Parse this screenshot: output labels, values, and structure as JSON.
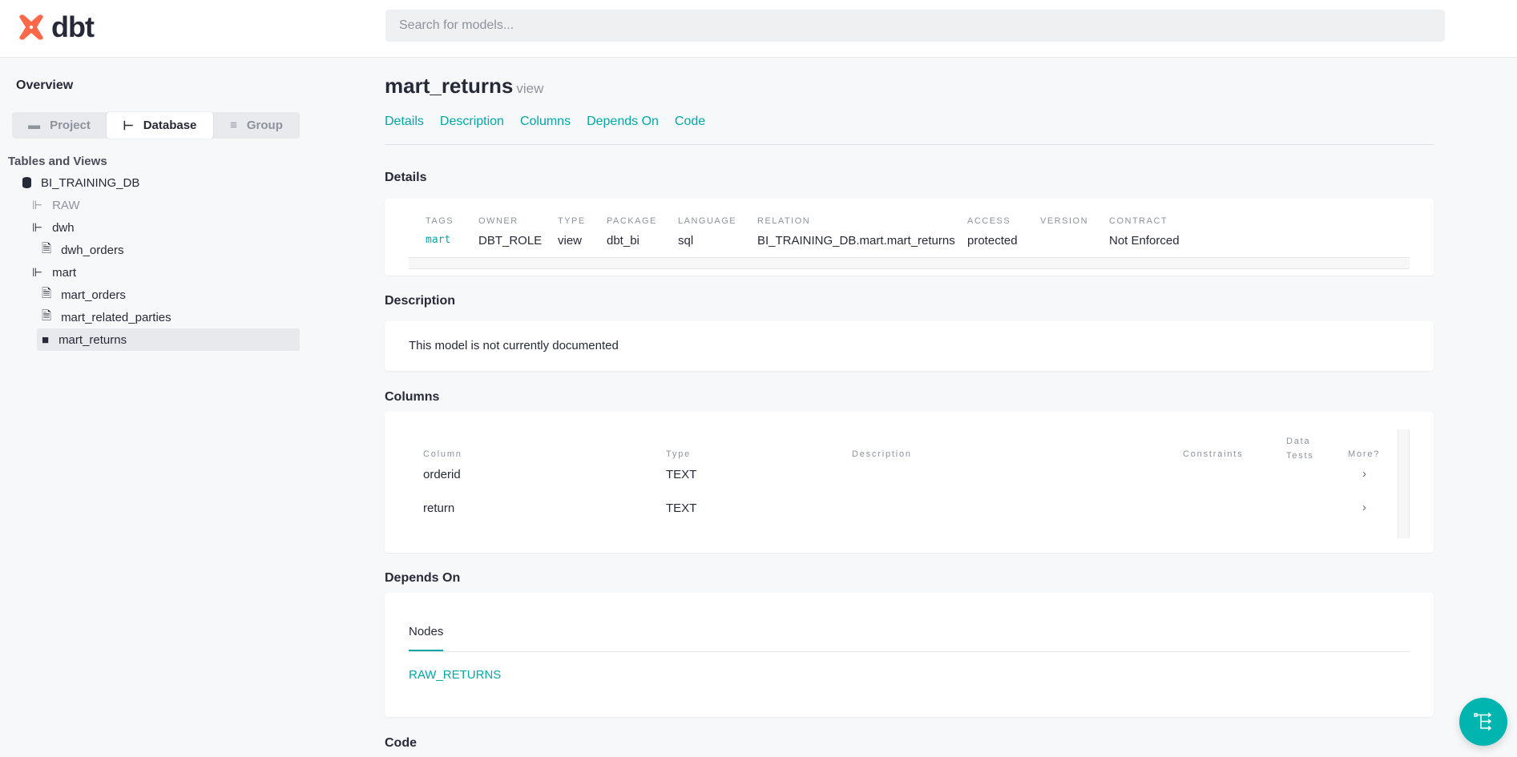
{
  "header": {
    "logo": "dbt",
    "search_placeholder": "Search for models..."
  },
  "sidebar": {
    "overview": "Overview",
    "tabs": [
      "Project",
      "Database",
      "Group"
    ],
    "section": "Tables and Views",
    "tree": [
      {
        "label": "BI_TRAINING_DB",
        "icon": "database"
      },
      {
        "label": "RAW",
        "icon": "schema"
      },
      {
        "label": "dwh",
        "icon": "schema"
      },
      {
        "label": "dwh_orders",
        "icon": "file"
      },
      {
        "label": "mart",
        "icon": "schema"
      },
      {
        "label": "mart_orders",
        "icon": "file"
      },
      {
        "label": "mart_related_parties",
        "icon": "file"
      },
      {
        "label": "mart_returns",
        "icon": "file"
      }
    ]
  },
  "model": {
    "name": "mart_returns",
    "kind": "view"
  },
  "nav": [
    "Details",
    "Description",
    "Columns",
    "Depends On",
    "Code"
  ],
  "details": {
    "heading": "Details",
    "fields": [
      {
        "label": "Tags",
        "value": "mart"
      },
      {
        "label": "Owner",
        "value": "DBT_ROLE"
      },
      {
        "label": "Type",
        "value": "view"
      },
      {
        "label": "Package",
        "value": "dbt_bi"
      },
      {
        "label": "Language",
        "value": "sql"
      },
      {
        "label": "Relation",
        "value": "BI_TRAINING_DB.mart.mart_returns"
      },
      {
        "label": "Access",
        "value": "protected"
      },
      {
        "label": "Version",
        "value": ""
      },
      {
        "label": "Contract",
        "value": "Not Enforced"
      }
    ]
  },
  "description": {
    "heading": "Description",
    "text": "This model is not currently documented"
  },
  "columns": {
    "heading": "Columns",
    "headers": [
      "Column",
      "Type",
      "Description",
      "Constraints",
      "Data Tests",
      "More?"
    ],
    "rows": [
      {
        "name": "orderid",
        "type": "TEXT",
        "more": "›"
      },
      {
        "name": "return",
        "type": "TEXT",
        "more": "›"
      }
    ]
  },
  "depends_on": {
    "heading": "Depends On",
    "tab": "Nodes",
    "nodes": [
      "RAW_RETURNS"
    ]
  },
  "code": {
    "heading": "Code"
  },
  "colors": {
    "accent": "#00a8a8",
    "brand": "#ff694a"
  }
}
